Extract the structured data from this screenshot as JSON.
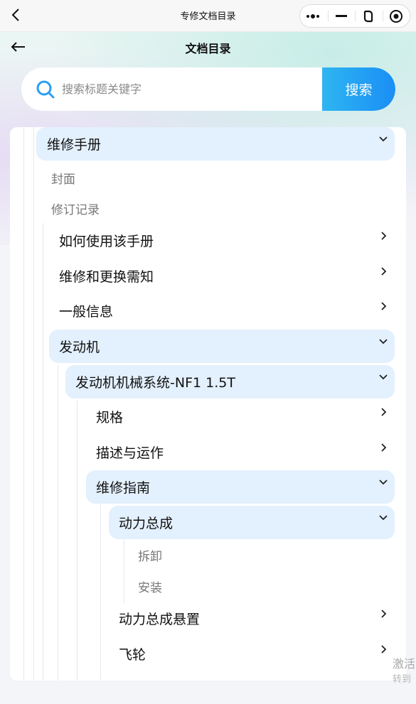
{
  "topbar": {
    "title": "专修文档目录",
    "icons": [
      "back-chevron-icon",
      "more-dots-icon",
      "minimize-icon",
      "rotate-icon",
      "close-circle-icon"
    ]
  },
  "header": {
    "title": "文档目录"
  },
  "search": {
    "placeholder": "搜索标题关键字",
    "value": "",
    "button_label": "搜索"
  },
  "tree": {
    "root_label": "维修手册",
    "items": {
      "cover": "封面",
      "revision": "修订记录",
      "howto": "如何使用该手册",
      "notice": "维修和更换需知",
      "general": "一般信息",
      "engine": "发动机",
      "engine_mech": "发动机机械系统-NF1 1.5T",
      "spec": "规格",
      "desc": "描述与运作",
      "guide": "维修指南",
      "powertrain": "动力总成",
      "remove": "拆卸",
      "install": "安装",
      "mount": "动力总成悬置",
      "flywheel": "飞轮"
    }
  },
  "watermark": {
    "line1": "激活",
    "line2": "转到"
  },
  "colors": {
    "accent": "#1a8ef5",
    "open_row_bg": "#e3f0fd"
  }
}
